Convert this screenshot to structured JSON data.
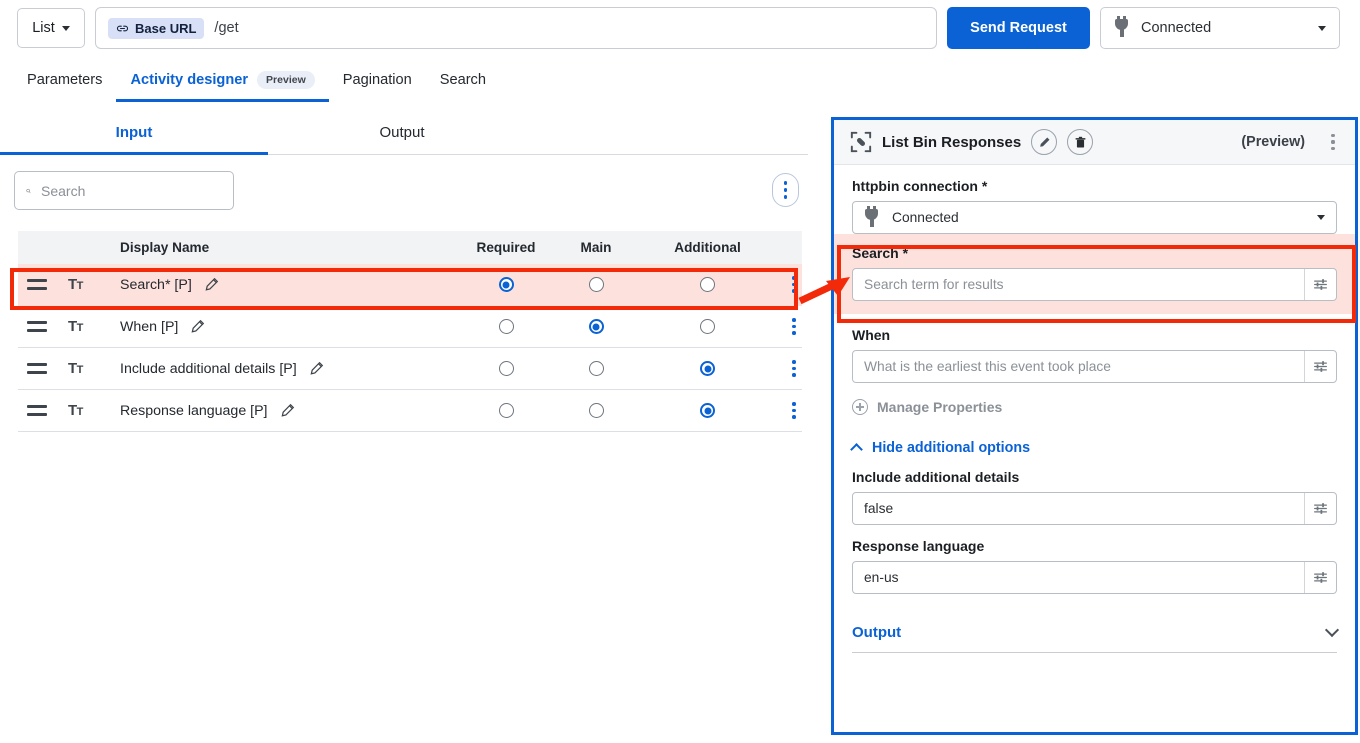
{
  "topbar": {
    "list_label": "List",
    "base_url_badge": "Base URL",
    "url_value": "/get",
    "send_button": "Send Request",
    "connection_status": "Connected"
  },
  "main_tabs": [
    {
      "label": "Parameters",
      "active": false,
      "badge": ""
    },
    {
      "label": "Activity designer",
      "active": true,
      "badge": "Preview"
    },
    {
      "label": "Pagination",
      "active": false,
      "badge": ""
    },
    {
      "label": "Search",
      "active": false,
      "badge": ""
    }
  ],
  "io_tabs": [
    {
      "label": "Input",
      "active": true
    },
    {
      "label": "Output",
      "active": false
    }
  ],
  "search": {
    "placeholder": "Search",
    "value": ""
  },
  "table": {
    "columns": [
      "Display Name",
      "Required",
      "Main",
      "Additional"
    ],
    "rows": [
      {
        "name": "Search* [P]",
        "required": true,
        "main": false,
        "additional": false,
        "highlighted": true
      },
      {
        "name": "When [P]",
        "required": false,
        "main": true,
        "additional": false,
        "highlighted": false
      },
      {
        "name": "Include additional details [P]",
        "required": false,
        "main": false,
        "additional": true,
        "highlighted": false
      },
      {
        "name": "Response language [P]",
        "required": false,
        "main": false,
        "additional": true,
        "highlighted": false
      }
    ]
  },
  "panel": {
    "title": "List Bin Responses",
    "preview_label": "(Preview)",
    "connection": {
      "label": "httpbin connection *",
      "value": "Connected"
    },
    "fields": [
      {
        "label": "Search *",
        "placeholder": "Search term for results",
        "value": "",
        "highlighted": true
      },
      {
        "label": "When",
        "placeholder": "What is the earliest this event took place",
        "value": "",
        "highlighted": false
      }
    ],
    "manage_properties": "Manage Properties",
    "hide_additional_options": "Hide additional options",
    "additional_fields": [
      {
        "label": "Include additional details",
        "value": "false"
      },
      {
        "label": "Response language",
        "value": "en-us"
      }
    ],
    "output_section": "Output"
  },
  "colors": {
    "accent_blue": "#0b62d4",
    "annotation_red": "#f32a0a",
    "highlight_pink": "#fde1dc"
  }
}
